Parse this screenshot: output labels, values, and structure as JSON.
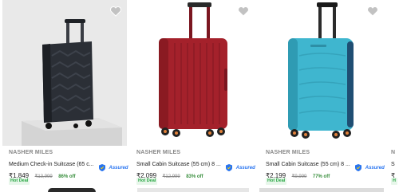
{
  "products": [
    {
      "brand": "NASHER MILES",
      "title": "Medium Check-in Suitcase (65 c...",
      "assured": "Assured",
      "price": "₹1,849",
      "mrp": "₹13,999",
      "discount": "86% off",
      "deal": "Hot Deal",
      "color": "#2b2f36"
    },
    {
      "brand": "NASHER MILES",
      "title": "Small Cabin Suitcase (55 cm) 8 ...",
      "assured": "Assured",
      "price": "₹2,099",
      "mrp": "₹12,999",
      "discount": "83% off",
      "deal": "Hot Deal",
      "color": "#a4212b"
    },
    {
      "brand": "NASHER MILES",
      "title": "Small Cabin Suitcase (55 cm) 8 ...",
      "assured": "Assured",
      "price": "₹2,199",
      "mrp": "₹9,999",
      "discount": "77% off",
      "deal": "Hot Deal",
      "color": "#3fb6cf"
    },
    {
      "brand": "N",
      "title": "S",
      "price": "₹",
      "deal": "H"
    }
  ],
  "colors": {
    "brand_text": "#878787",
    "discount": "#388e3c",
    "assured_blue": "#2874f0",
    "deal_bg": "#e7f6ea",
    "deal_text": "#26a541"
  },
  "icons": {
    "wishlist": "heart-icon",
    "assured": "shield-icon"
  }
}
